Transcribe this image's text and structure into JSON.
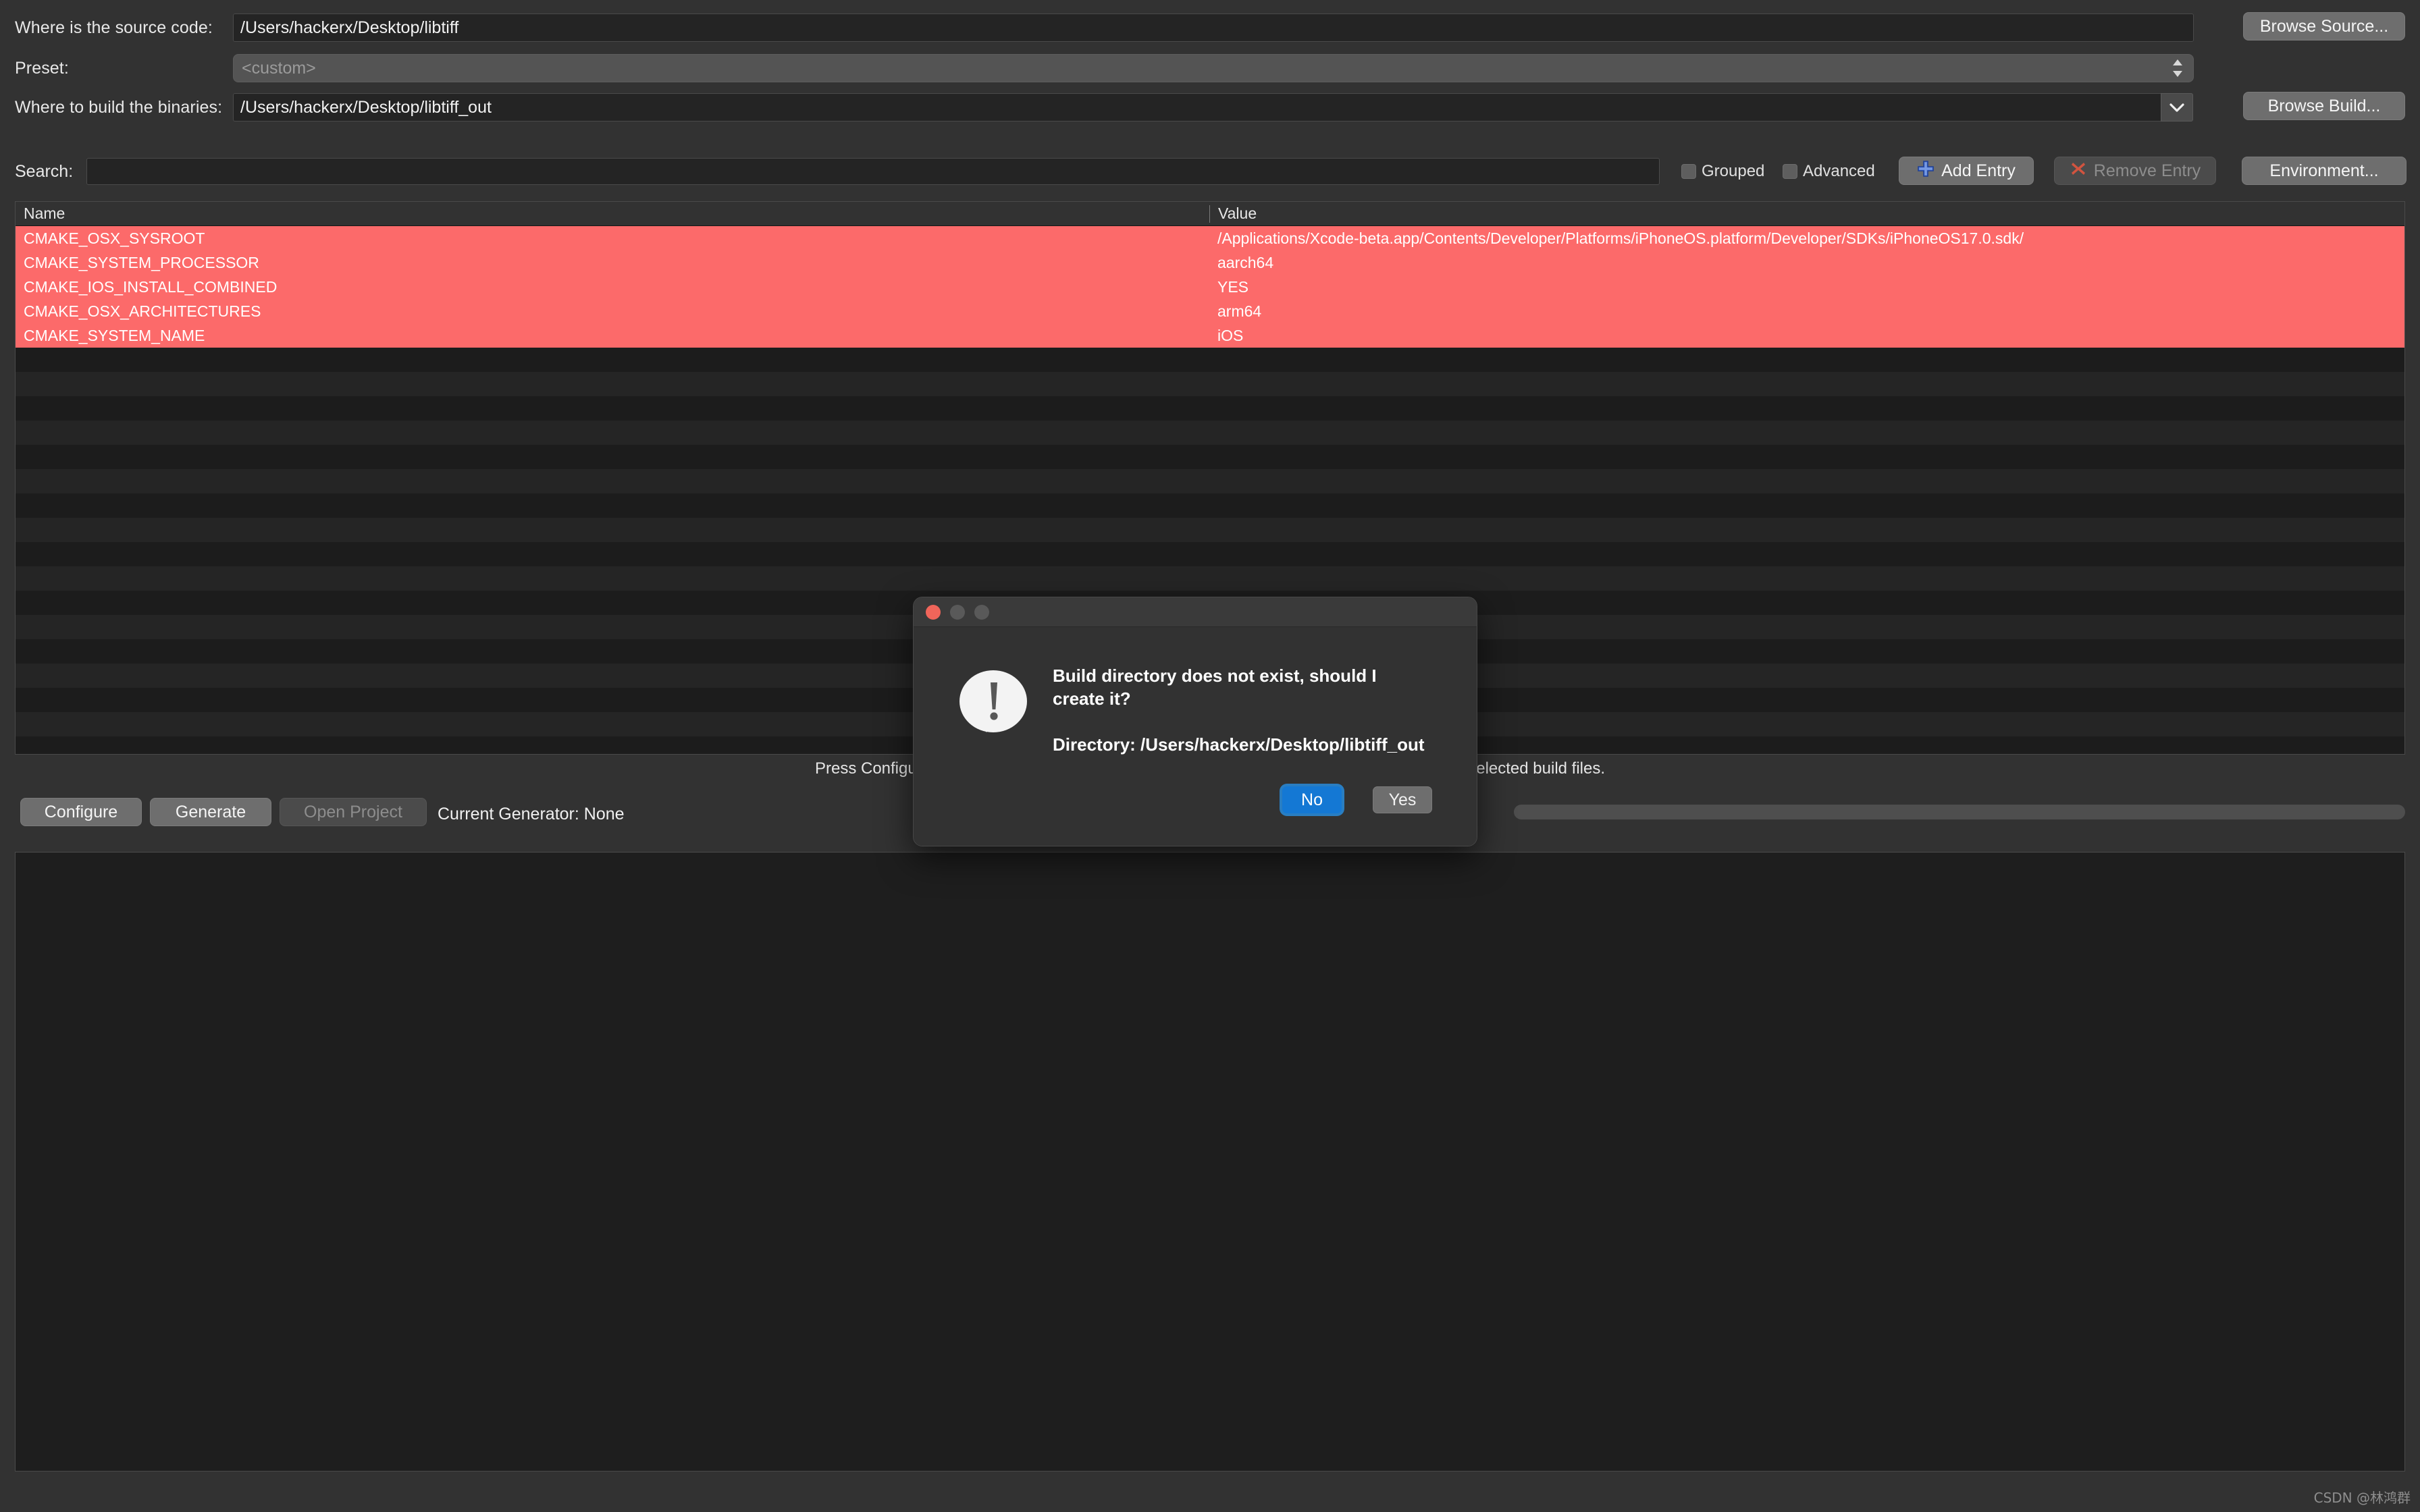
{
  "form": {
    "source_label": "Where is the source code:",
    "source_value": "/Users/hackerx/Desktop/libtiff",
    "preset_label": "Preset:",
    "preset_value": "<custom>",
    "build_label": "Where to build the binaries:",
    "build_value": "/Users/hackerx/Desktop/libtiff_out",
    "browse_source_label": "Browse Source...",
    "browse_build_label": "Browse Build..."
  },
  "search": {
    "label": "Search:",
    "value": "",
    "placeholder": "",
    "grouped_label": "Grouped",
    "advanced_label": "Advanced",
    "add_entry_label": "Add Entry",
    "remove_entry_label": "Remove Entry",
    "environment_label": "Environment..."
  },
  "table": {
    "columns": [
      "Name",
      "Value"
    ],
    "rows": [
      {
        "name": "CMAKE_OSX_SYSROOT",
        "value": "/Applications/Xcode-beta.app/Contents/Developer/Platforms/iPhoneOS.platform/Developer/SDKs/iPhoneOS17.0.sdk/",
        "selected": true
      },
      {
        "name": "CMAKE_SYSTEM_PROCESSOR",
        "value": "aarch64",
        "selected": true
      },
      {
        "name": "CMAKE_IOS_INSTALL_COMBINED",
        "value": "YES",
        "selected": true
      },
      {
        "name": "CMAKE_OSX_ARCHITECTURES",
        "value": "arm64",
        "selected": true
      },
      {
        "name": "CMAKE_SYSTEM_NAME",
        "value": "iOS",
        "selected": true
      }
    ],
    "empty_row_count": 17,
    "selection_color": "#fc6a6a"
  },
  "hint": "Press Configure to update and display new values in red, then press Generate to generate selected build files.",
  "bottom": {
    "configure_label": "Configure",
    "generate_label": "Generate",
    "open_project_label": "Open Project",
    "current_generator": "Current Generator: None",
    "progress_percent": 0
  },
  "dialog": {
    "title": "",
    "message_line1": "Build directory does not exist, should I create it?",
    "message_line2": "Directory: /Users/hackerx/Desktop/libtiff_out",
    "no_label": "No",
    "yes_label": "Yes",
    "focus_color": "#1478d4"
  },
  "watermark": "CSDN @林鸿群"
}
